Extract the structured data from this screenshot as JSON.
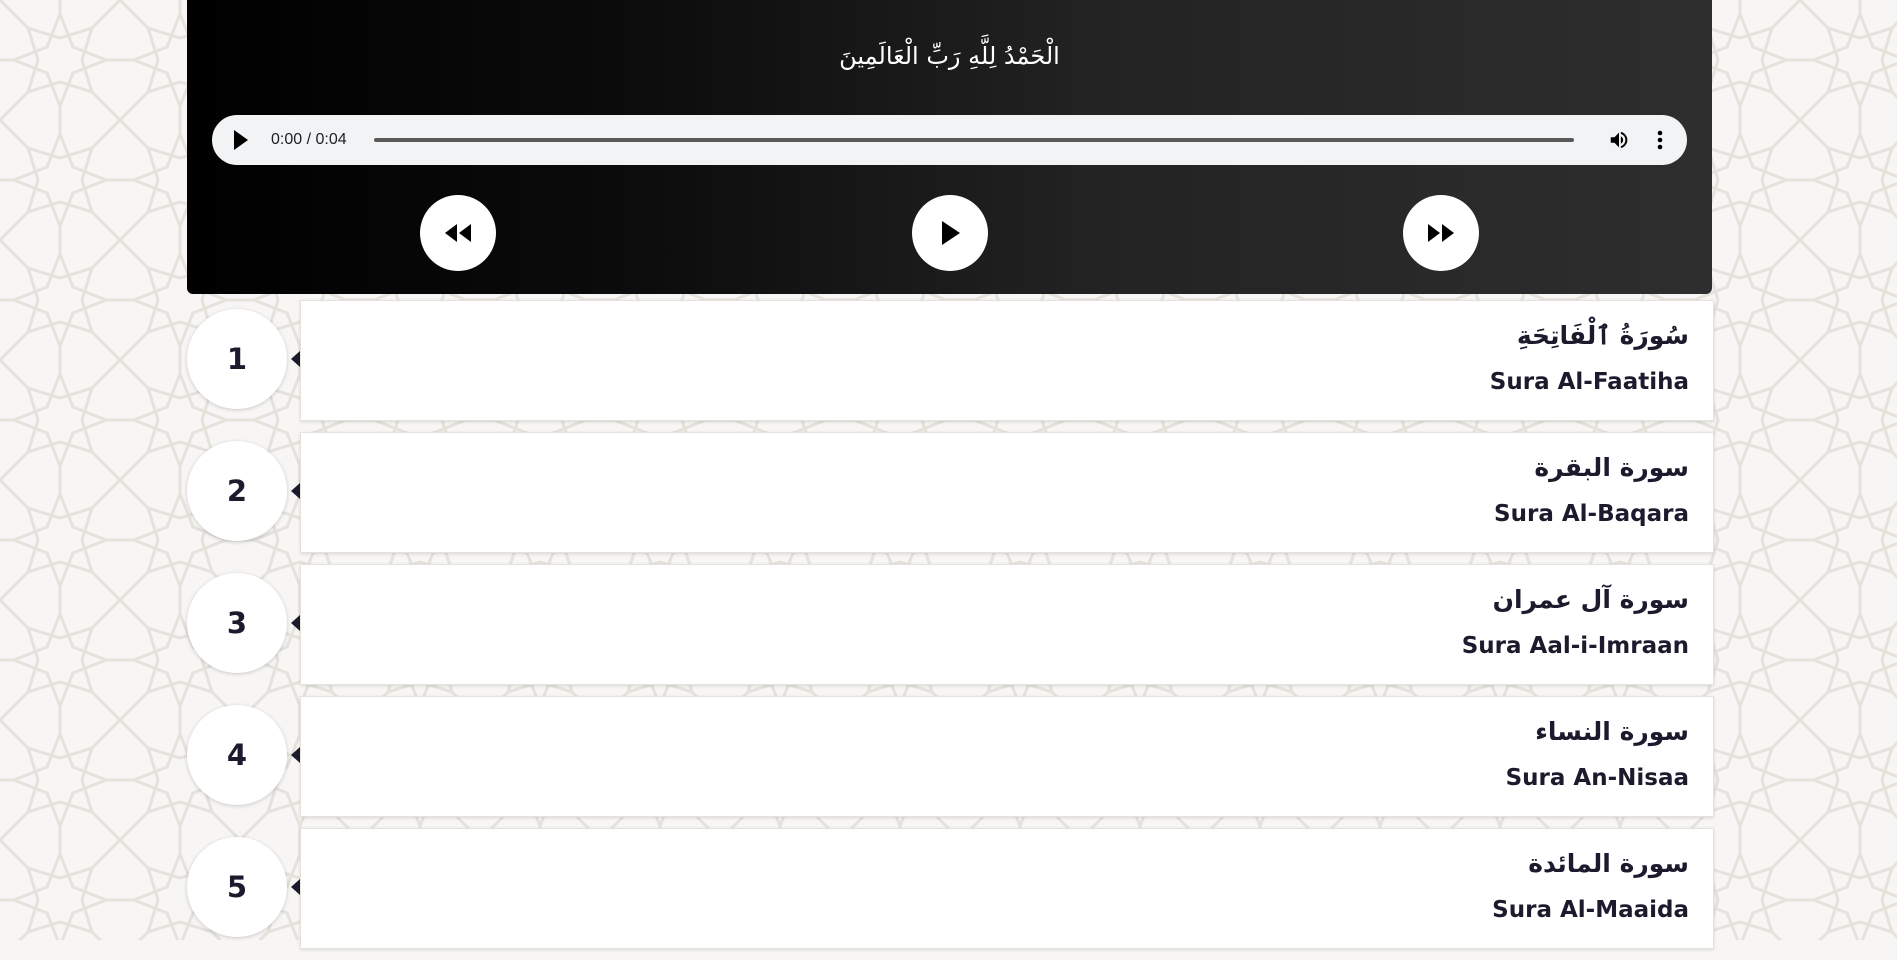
{
  "player": {
    "verse": "الْحَمْدُ لِلَّهِ رَبِّ الْعَالَمِينَ",
    "audio": {
      "time": "0:00 / 0:04"
    }
  },
  "suras": [
    {
      "number": "1",
      "arabic": "سُورَةُ ٱلْفَاتِحَةِ",
      "english": "Sura Al-Faatiha"
    },
    {
      "number": "2",
      "arabic": "سورة البقرة",
      "english": "Sura Al-Baqara"
    },
    {
      "number": "3",
      "arabic": "سورة آل عمران",
      "english": "Sura Aal-i-Imraan"
    },
    {
      "number": "4",
      "arabic": "سورة النساء",
      "english": "Sura An-Nisaa"
    },
    {
      "number": "5",
      "arabic": "سورة المائدة",
      "english": "Sura Al-Maaida"
    }
  ],
  "colors": {
    "text_dark": "#1e1a2e",
    "player_dark": "#000000",
    "player_light": "#2e2e2e",
    "audio_bar": "#f1f3f4"
  }
}
